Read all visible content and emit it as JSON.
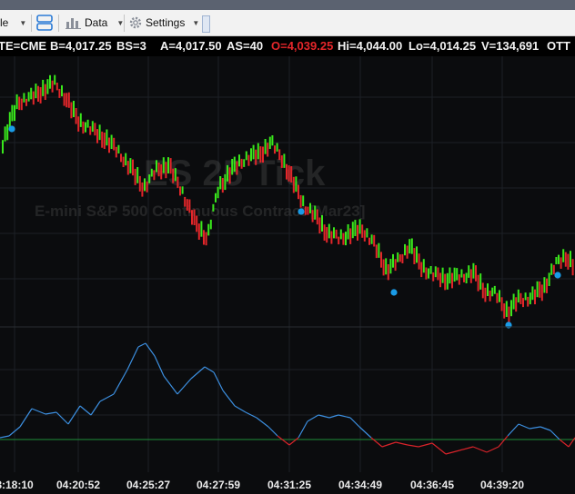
{
  "toolbar": {
    "style_label": "le",
    "data_label": "Data",
    "settings_label": "Settings"
  },
  "info": {
    "exchange": "TE=CME",
    "bid": "B=4,017.25",
    "bid_size": "BS=3",
    "ask": "A=4,017.50",
    "ask_size": "AS=40",
    "open": "O=4,039.25",
    "high": "Hi=4,044.00",
    "low": "Lo=4,014.25",
    "volume": "V=134,691",
    "indicator": "OTT"
  },
  "watermark": {
    "symbol": "ES 25 Tick",
    "description": "E-mini S&P 500 Continuous Contract [Mar23]"
  },
  "time_axis": [
    "8:18:10",
    "04:20:52",
    "04:25:27",
    "04:27:59",
    "04:31:25",
    "04:34:49",
    "04:36:45",
    "04:39:20"
  ],
  "colors": {
    "up": "#39e81c",
    "down": "#e3262a",
    "marker": "#1a9be6",
    "oscillator_up": "#3c8fe0",
    "oscillator_down": "#d9232a",
    "zero_line": "#1f8f3a",
    "grid": "#1d2026"
  }
}
